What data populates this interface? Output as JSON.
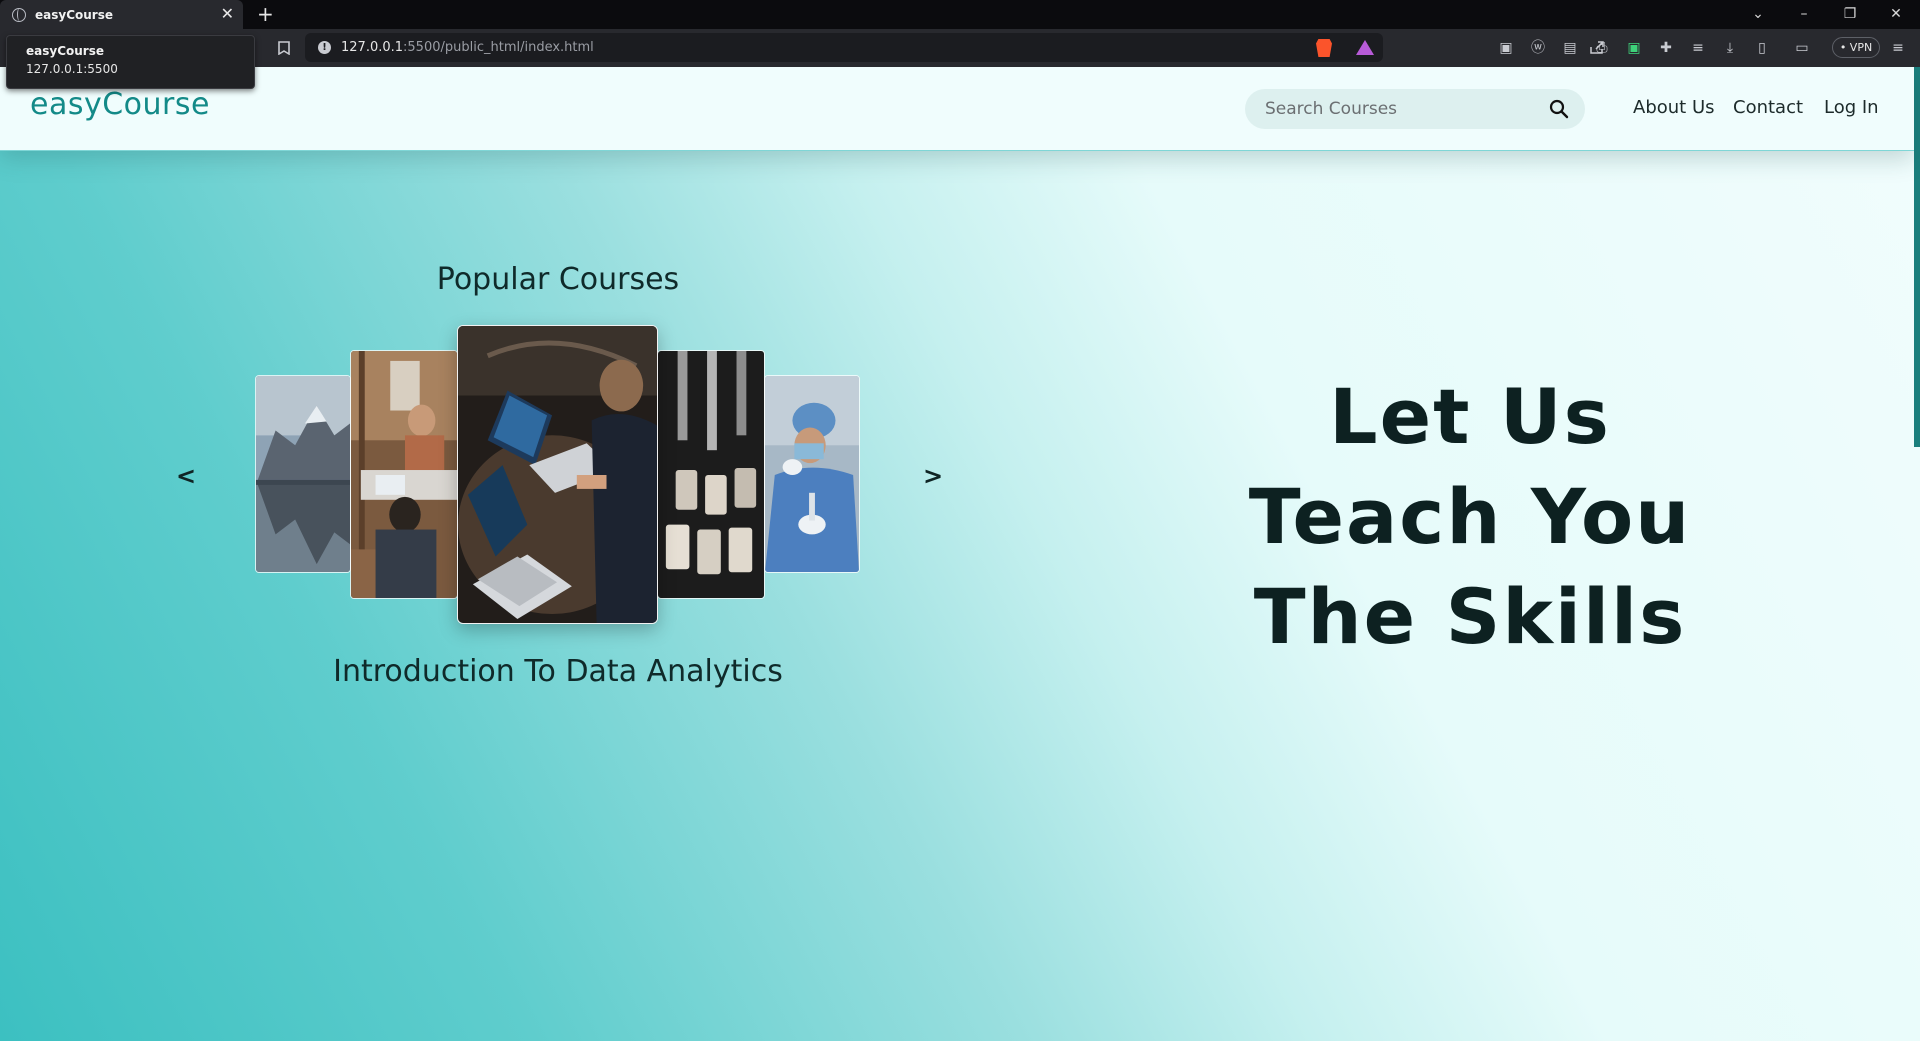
{
  "browser": {
    "tab_title": "easyCourse",
    "url_host": "127.0.0.1",
    "url_rest": ":5500/public_html/index.html",
    "tooltip_title": "easyCourse",
    "tooltip_url": "127.0.0.1:5500",
    "vpn_label": "• VPN",
    "new_tab_glyph": "+",
    "close_glyph": "✕"
  },
  "site": {
    "logo": "easyCourse",
    "search_placeholder": "Search Courses",
    "nav": [
      "About Us",
      "Contact",
      "Log In"
    ]
  },
  "carousel": {
    "title": "Popular Courses",
    "prev": "<",
    "next": ">",
    "current_course": "Introduction To Data Analytics",
    "slides": [
      "mountain-lake",
      "team-meeting",
      "laptop-work",
      "lab-vials",
      "lab-technician"
    ]
  },
  "hero": {
    "lines": [
      "Let Us",
      "Teach You",
      "The Skills"
    ]
  },
  "colors": {
    "brand": "#138a88",
    "accent_gradient_start": "#3cc0c1",
    "accent_gradient_end": "#f1fdfd"
  }
}
